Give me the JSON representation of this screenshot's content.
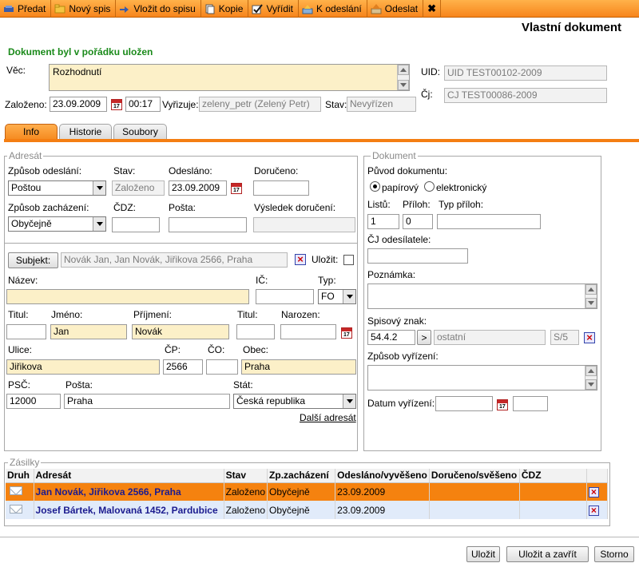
{
  "toolbar": {
    "items": [
      {
        "label": "Předat",
        "icon": "hand-icon"
      },
      {
        "label": "Nový spis",
        "icon": "folder-icon"
      },
      {
        "label": "Vložit do spisu",
        "icon": "insert-icon"
      },
      {
        "label": "Kopie",
        "icon": "copy-icon"
      },
      {
        "label": "Vyřídit",
        "icon": "check-icon"
      },
      {
        "label": "K odeslání",
        "icon": "outbox-icon"
      },
      {
        "label": "Odeslat",
        "icon": "send-icon"
      }
    ],
    "close_label": "✖"
  },
  "page_title": "Vlastní dokument",
  "status_message": "Dokument byl v pořádku uložen",
  "header": {
    "vec_label": "Věc:",
    "vec_value": "Rozhodnutí",
    "uid_label": "UID:",
    "uid_value": "UID TEST00102-2009",
    "cj_label": "Čj:",
    "cj_value": "CJ TEST00086-2009",
    "zalozeno_label": "Založeno:",
    "zalozeno_date": "23.09.2009",
    "zalozeno_time": "00:17",
    "vyrizuje_label": "Vyřizuje:",
    "vyrizuje_value": "zeleny_petr (Zelený Petr)",
    "stav_label": "Stav:",
    "stav_value": "Nevyřízen"
  },
  "tabs": [
    {
      "label": "Info",
      "active": true
    },
    {
      "label": "Historie",
      "active": false
    },
    {
      "label": "Soubory",
      "active": false
    }
  ],
  "adresat": {
    "legend": "Adresát",
    "zpusob_odeslani_label": "Způsob odeslání:",
    "zpusob_odeslani_value": "Poštou",
    "stav_label": "Stav:",
    "stav_value": "Založeno",
    "odeslano_label": "Odesláno:",
    "odeslano_value": "23.09.2009",
    "doruceno_label": "Doručeno:",
    "doruceno_value": "",
    "zpusob_zachazeni_label": "Způsob zacházení:",
    "zpusob_zachazeni_value": "Obyčejně",
    "cdz_label": "ČDZ:",
    "posta_label": "Pošta:",
    "vysledek_label": "Výsledek doručení:",
    "subjekt_button": "Subjekt:",
    "subjekt_value": "Novák Jan, Jan Novák, Jiřikova 2566, Praha",
    "ulozit_label": "Uložit:",
    "nazev_label": "Název:",
    "ic_label": "IČ:",
    "typ_label": "Typ:",
    "typ_value": "FO",
    "titul_label": "Titul:",
    "jmeno_label": "Jméno:",
    "jmeno_value": "Jan",
    "prijmeni_label": "Příjmení:",
    "prijmeni_value": "Novák",
    "titul2_label": "Titul:",
    "narozen_label": "Narozen:",
    "ulice_label": "Ulice:",
    "ulice_value": "Jiřikova",
    "cp_label": "ČP:",
    "cp_value": "2566",
    "co_label": "ČO:",
    "obec_label": "Obec:",
    "obec_value": "Praha",
    "psc_label": "PSČ:",
    "psc_value": "12000",
    "posta2_label": "Pošta:",
    "posta2_value": "Praha",
    "stat_label": "Stát:",
    "stat_value": "Česká republika",
    "dalsi_link": "Další adresát"
  },
  "dokument": {
    "legend": "Dokument",
    "puvod_label": "Původ dokumentu:",
    "papirovy_label": "papírový",
    "elektronicky_label": "elektronický",
    "listu_label": "Listů:",
    "listu_value": "1",
    "priloh_label": "Příloh:",
    "priloh_value": "0",
    "typ_priloh_label": "Typ příloh:",
    "cj_odesilatele_label": "ČJ odesílatele:",
    "poznamka_label": "Poznámka:",
    "spisovy_znak_label": "Spisový znak:",
    "spisovy_znak_value": "54.4.2",
    "arrow_label": ">",
    "spisovy_text": "ostatní",
    "spisovy_code": "S/5",
    "zpusob_vyrizeni_label": "Způsob vyřízení:",
    "datum_vyrizeni_label": "Datum vyřízení:"
  },
  "zasilky": {
    "legend": "Zásilky",
    "columns": [
      "Druh",
      "Adresát",
      "Stav",
      "Zp.zacházení",
      "Odesláno/vyvěšeno",
      "Doručeno/svěšeno",
      "ČDZ",
      ""
    ],
    "rows": [
      {
        "adresat": "Jan Novák, Jiřikova 2566, Praha",
        "stav": "Založeno",
        "zachazeni": "Obyčejně",
        "odeslano": "23.09.2009",
        "doruceno": "",
        "cdz": "",
        "selected": true
      },
      {
        "adresat": "Josef Bártek, Malovaná 1452, Pardubice",
        "stav": "Založeno",
        "zachazeni": "Obyčejně",
        "odeslano": "23.09.2009",
        "doruceno": "",
        "cdz": "",
        "selected": false
      }
    ]
  },
  "footer": {
    "ulozit": "Uložit",
    "ulozit_zavrit": "Uložit a zavřít",
    "storno": "Storno"
  },
  "calendar_icon_text": "17",
  "colors": {
    "accent": "#f47e12",
    "selected_row": "#f5820f",
    "alt_row": "#e1ebfa",
    "status_green": "#1a8a1a",
    "required_field": "#fcf0c8"
  }
}
